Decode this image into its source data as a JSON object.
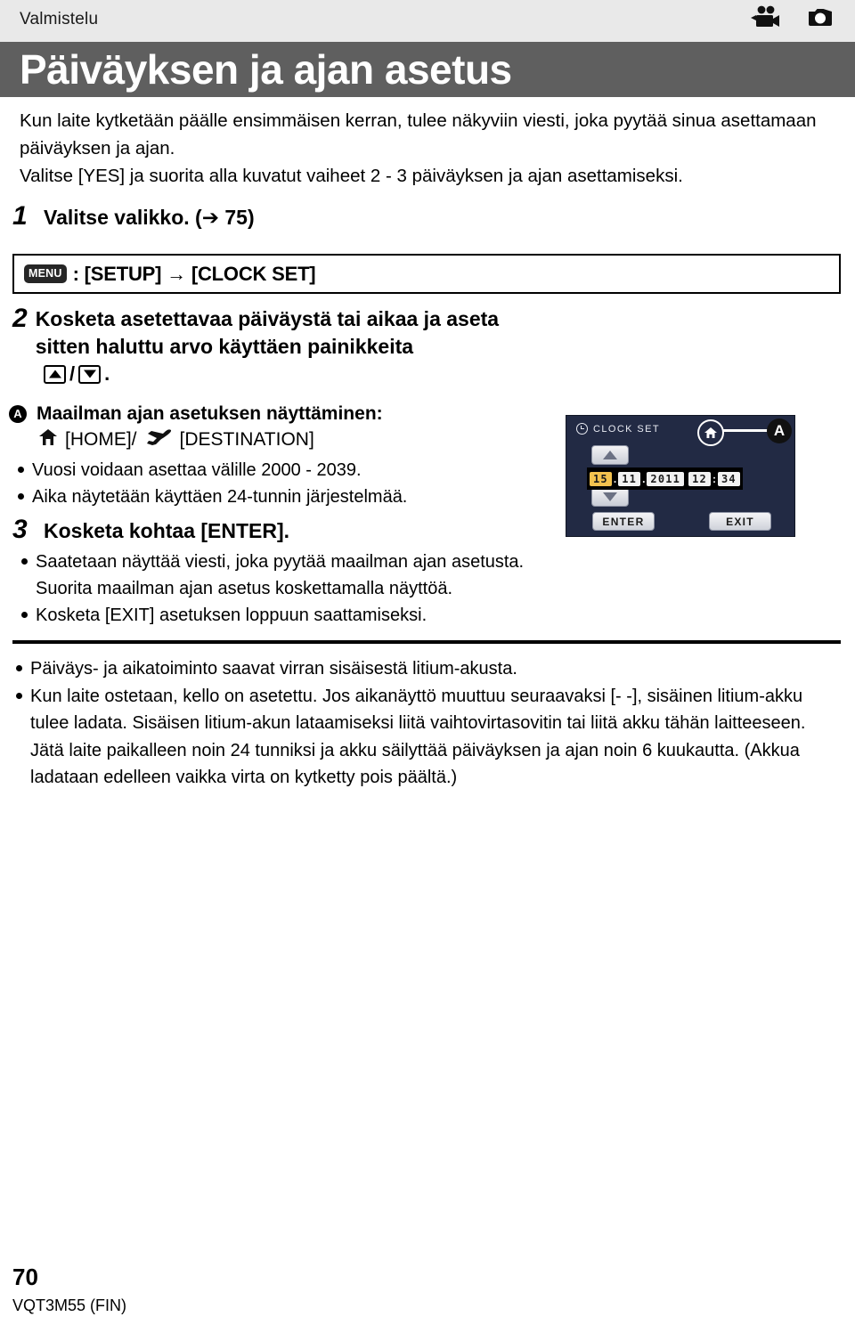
{
  "header": {
    "chapter": "Valmistelu",
    "title": "Päiväyksen ja ajan asetus",
    "icons": [
      "movie-camera-icon",
      "still-camera-icon"
    ]
  },
  "intro": {
    "line1": "Kun laite kytketään päälle ensimmäisen kerran, tulee näkyviin viesti, joka pyytää sinua asettamaan päiväyksen ja ajan.",
    "line2": "Valitse [YES] ja suorita alla kuvatut vaiheet 2 - 3 päiväyksen ja ajan asettamiseksi."
  },
  "step1": {
    "number": "1",
    "title": "Valitse valikko. (➔ 75)",
    "menu_chip": "MENU",
    "menu_path": ": [SETUP] → [CLOCK SET]"
  },
  "step2": {
    "number": "2",
    "title": "Kosketa asetettavaa päiväystä tai aikaa ja aseta sitten haluttu arvo käyttäen painikkeita",
    "keys_suffix": " / ",
    "keys_period": ".",
    "key_up": "up-arrow-key",
    "key_down": "down-arrow-key"
  },
  "sectionA": {
    "marker": "A",
    "heading": "Maailman ajan asetuksen näyttäminen:",
    "home_label": "[HOME]/",
    "destination_label": "[DESTINATION]",
    "bullets": [
      "Vuosi voidaan asettaa välille 2000 - 2039.",
      "Aika näytetään käyttäen 24-tunnin järjestelmää."
    ]
  },
  "step3": {
    "number": "3",
    "title": "Kosketa kohtaa [ENTER].",
    "bullets": [
      "Saatetaan näyttää viesti, joka pyytää maailman ajan asetusta. Suorita maailman ajan asetus koskettamalla näyttöä.",
      "Kosketa [EXIT] asetuksen loppuun saattamiseksi."
    ]
  },
  "footnotes": [
    "Päiväys- ja aikatoiminto saavat virran sisäisestä litium-akusta.",
    "Kun laite ostetaan, kello on asetettu. Jos aikanäyttö muuttuu seuraavaksi [- -], sisäinen litium-akku tulee ladata. Sisäisen litium-akun lataamiseksi liitä vaihtovirtasovitin tai liitä akku tähän laitteeseen. Jätä laite paikalleen noin 24 tunniksi ja akku säilyttää päiväyksen ja ajan noin 6 kuukautta. (Akkua ladataan edelleen vaikka virta on kytketty pois päältä.)"
  ],
  "lcd": {
    "screen_title": "CLOCK SET",
    "clock_icon": "clock-icon",
    "home_icon": "home-icon",
    "callout_label": "A",
    "up_button": "up-arrow-button",
    "down_button": "down-arrow-button",
    "date": {
      "day": "15",
      "month": "11",
      "year": "2011",
      "sep1": ".",
      "sep2": "."
    },
    "time": {
      "hour": "12",
      "minute": "34",
      "sep": ":"
    },
    "enter_label": "ENTER",
    "exit_label": "EXIT",
    "colors": {
      "screen_bg": "#222a44",
      "selected_field": "#f3c24f",
      "field_bg": "#f2f2f2"
    }
  },
  "footer": {
    "page_number": "70",
    "doc_code": "VQT3M55 (FIN)"
  },
  "colors": {
    "header_strip": "#e9e9e9",
    "title_bar": "#5f5f5f",
    "title_text": "#ffffff"
  }
}
